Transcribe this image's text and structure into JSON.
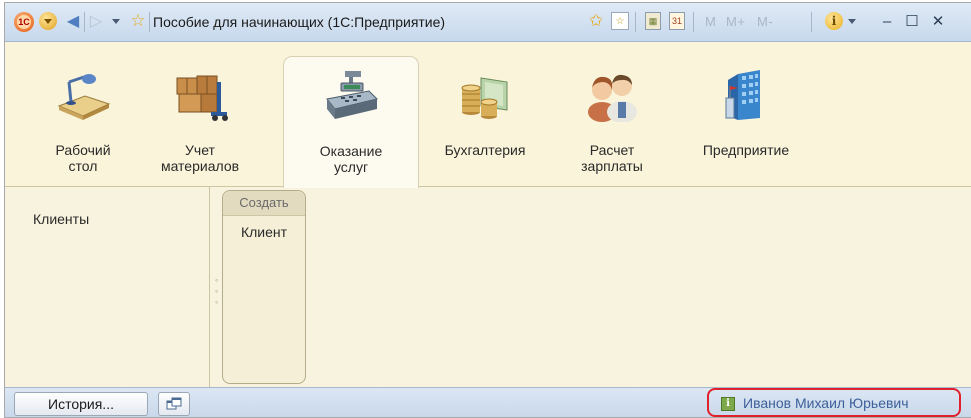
{
  "window": {
    "title": "Пособие для начинающих (1С:Предприятие)",
    "app_badge": "1С",
    "memory_buttons": [
      "M",
      "M+",
      "M-"
    ],
    "info_glyph": "i"
  },
  "sections": [
    {
      "label_line1": "Рабочий",
      "label_line2": "стол",
      "icon": "desk-lamp-icon",
      "active": false
    },
    {
      "label_line1": "Учет",
      "label_line2": "материалов",
      "icon": "boxes-cart-icon",
      "active": false
    },
    {
      "label_line1": "Оказание",
      "label_line2": "услуг",
      "icon": "cash-register-icon",
      "active": true
    },
    {
      "label_line1": "Бухгалтерия",
      "label_line2": "",
      "icon": "coins-banknotes-icon",
      "active": false
    },
    {
      "label_line1": "Расчет",
      "label_line2": "зарплаты",
      "icon": "people-icon",
      "active": false
    },
    {
      "label_line1": "Предприятие",
      "label_line2": "",
      "icon": "office-building-icon",
      "active": false
    }
  ],
  "navigation": {
    "items": [
      "Клиенты"
    ]
  },
  "actions": {
    "create_header": "Создать",
    "create_items": [
      "Клиент"
    ]
  },
  "statusbar": {
    "history_label": "История...",
    "user_name": "Иванов Михаил Юрьевич",
    "user_icon_glyph": "i"
  },
  "colors": {
    "panel_background": "#f8f3de",
    "titlebar": "#c7d8ec",
    "user_highlight_border": "#e0202a",
    "user_name_text": "#3d5f9a"
  }
}
